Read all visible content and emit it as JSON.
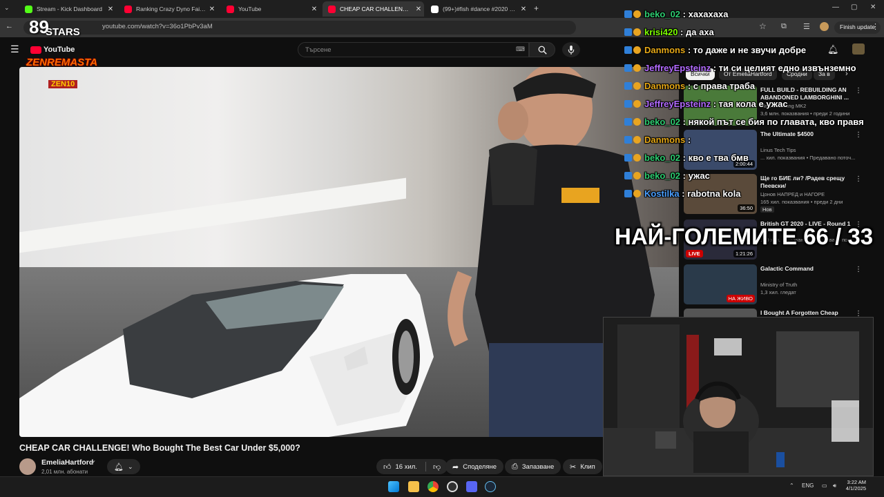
{
  "browser": {
    "tabs": [
      {
        "label": "Stream - Kick Dashboard",
        "color": "#53fc18",
        "active": false
      },
      {
        "label": "Ranking Crazy Dyno Fail Mome",
        "color": "#ff0033",
        "active": false
      },
      {
        "label": "YouTube",
        "color": "#ff0033",
        "active": false
      },
      {
        "label": "CHEAP CAR CHALLENGE! W",
        "color": "#ff0033",
        "active": true
      },
      {
        "label": "(99+)#fish #dance #2020 #fun",
        "color": "#ffffff",
        "active": false
      }
    ],
    "new_tab": "+",
    "url": "youtube.com/watch?v=36o1PbPv3aM",
    "finish_update": "Finish update"
  },
  "youtube": {
    "logo_text": "YouTube",
    "search_placeholder": "Търсене",
    "filter_chips": [
      "Всички",
      "От EmeliaHartford",
      "Сродни",
      "За в"
    ],
    "video": {
      "title": "CHEAP CAR CHALLENGE! Who Bought The Best Car Under $5,000?",
      "channel": "EmeliaHartford",
      "subscribers": "2,01 млн. абонати",
      "likes": "16 хил.",
      "share": "Споделяне",
      "save": "Запазване",
      "clip": "Клип"
    },
    "recommendations": [
      {
        "title": "FULL BUILD - REBUILDING AN ABANDONED LAMBORGHINI ...",
        "channel": "Mat Armstrong MK2",
        "meta": "3,6 млн. показвания • преди 2 години",
        "duration": "",
        "thumb": "#4a7a3a"
      },
      {
        "title": "The Ultimate $4500",
        "channel": "Linus Tech Tips",
        "meta": "... хил. показвания • Предавано поточ...",
        "duration": "2:00:44",
        "thumb": "#3a4a6a"
      },
      {
        "title": "Ще го БИЕ ли? /Радев срещу Пеевски/",
        "channel": "Цонов НАПРЕД и НАГОРЕ",
        "meta": "165 хил. показвания • преди 2 дни",
        "badge": "Нов",
        "duration": "36:50",
        "thumb": "#5a4a3a"
      },
      {
        "title": "British GT 2020 - LIVE - Round 1",
        "channel": "",
        "meta": "190 хил. показвания • Предавано поточ...",
        "duration": "1:21:26",
        "live_tag": "LIVE",
        "thumb": "#2a2a3a"
      },
      {
        "title": "Galactic Command",
        "channel": "Ministry of Truth",
        "meta": "1,3 хил. гледат",
        "duration": "",
        "live_badge": "НА ЖИВО",
        "thumb": "#2a3a4a"
      },
      {
        "title": "I Bought A Forgotten Cheap",
        "channel": "",
        "meta": "",
        "duration": "",
        "thumb": "#555555"
      }
    ]
  },
  "chat": [
    {
      "user": "beko_02",
      "color": "#2ecc71",
      "msg": "хахахаха"
    },
    {
      "user": "krisi420",
      "color": "#7cfc00",
      "msg": "да аха"
    },
    {
      "user": "Danmons",
      "color": "#e6a817",
      "msg": "то даже и не звучи добре"
    },
    {
      "user": "JeffreyEpsteinz",
      "color": "#b36bff",
      "msg": "ти си целият едно извънземно"
    },
    {
      "user": "Danmons",
      "color": "#e6a817",
      "msg": "с права траба"
    },
    {
      "user": "JeffreyEpsteinz",
      "color": "#b36bff",
      "msg": "тая кола е ужас"
    },
    {
      "user": "beko_02",
      "color": "#2ecc71",
      "msg": "някой път се бия по главата, кво правя"
    },
    {
      "user": "Danmons",
      "color": "#e6a817",
      "msg": ""
    },
    {
      "user": "beko_02",
      "color": "#2ecc71",
      "msg": "кво е тва бмв"
    },
    {
      "user": "beko_02",
      "color": "#2ecc71",
      "msg": "ужас"
    },
    {
      "user": "Kostilka",
      "color": "#4a9fff",
      "msg": "rabotna kola"
    }
  ],
  "overlay": {
    "big_text": "НАЙ-ГОЛЕМИТЕ 66 / 33",
    "logo_top": "89",
    "logo_stars": "STARS",
    "logo_name": "ZENREMASTA",
    "logo_sub": "ZEN10"
  },
  "taskbar": {
    "lang": "ENG",
    "time": "3:22 AM",
    "date": "4/1/2025"
  }
}
